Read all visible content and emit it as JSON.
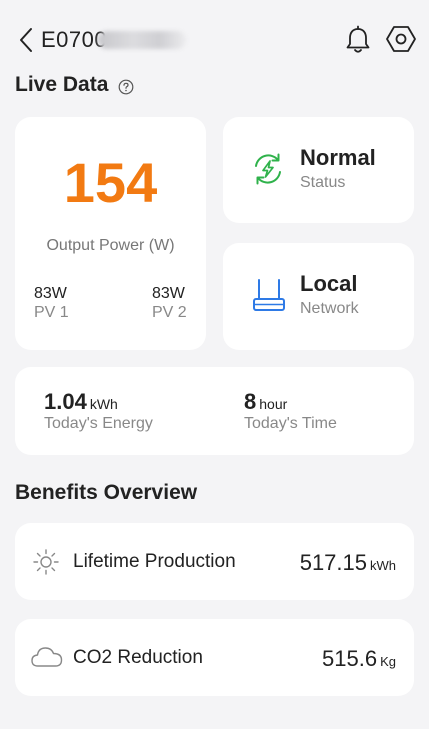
{
  "header": {
    "device_id": "E0700",
    "back_icon": "chevron-left-icon",
    "bell_icon": "bell-icon",
    "settings_icon": "hexagon-gear-icon"
  },
  "live_data": {
    "title": "Live Data",
    "help_icon": "question-circle-icon",
    "output_power": {
      "value": "154",
      "label": "Output Power (W)",
      "accent": "#f27a12"
    },
    "pv1": {
      "value": "83W",
      "label": "PV 1"
    },
    "pv2": {
      "value": "83W",
      "label": "PV 2"
    },
    "status": {
      "title": "Normal",
      "label": "Status",
      "icon": "sync-lightning-icon",
      "color": "#2fb24b"
    },
    "network": {
      "title": "Local",
      "label": "Network",
      "icon": "router-icon",
      "color": "#2e7ae6"
    },
    "energy": {
      "value": "1.04",
      "unit": "kWh",
      "label": "Today's Energy"
    },
    "time": {
      "value": "8",
      "unit": "hour",
      "label": "Today's Time"
    }
  },
  "benefits": {
    "title": "Benefits Overview",
    "lifetime": {
      "label": "Lifetime Production",
      "value": "517.15",
      "unit": "kWh",
      "icon": "sun-icon"
    },
    "co2": {
      "label": "CO2 Reduction",
      "value": "515.6",
      "unit": "Kg",
      "icon": "cloud-icon"
    }
  }
}
